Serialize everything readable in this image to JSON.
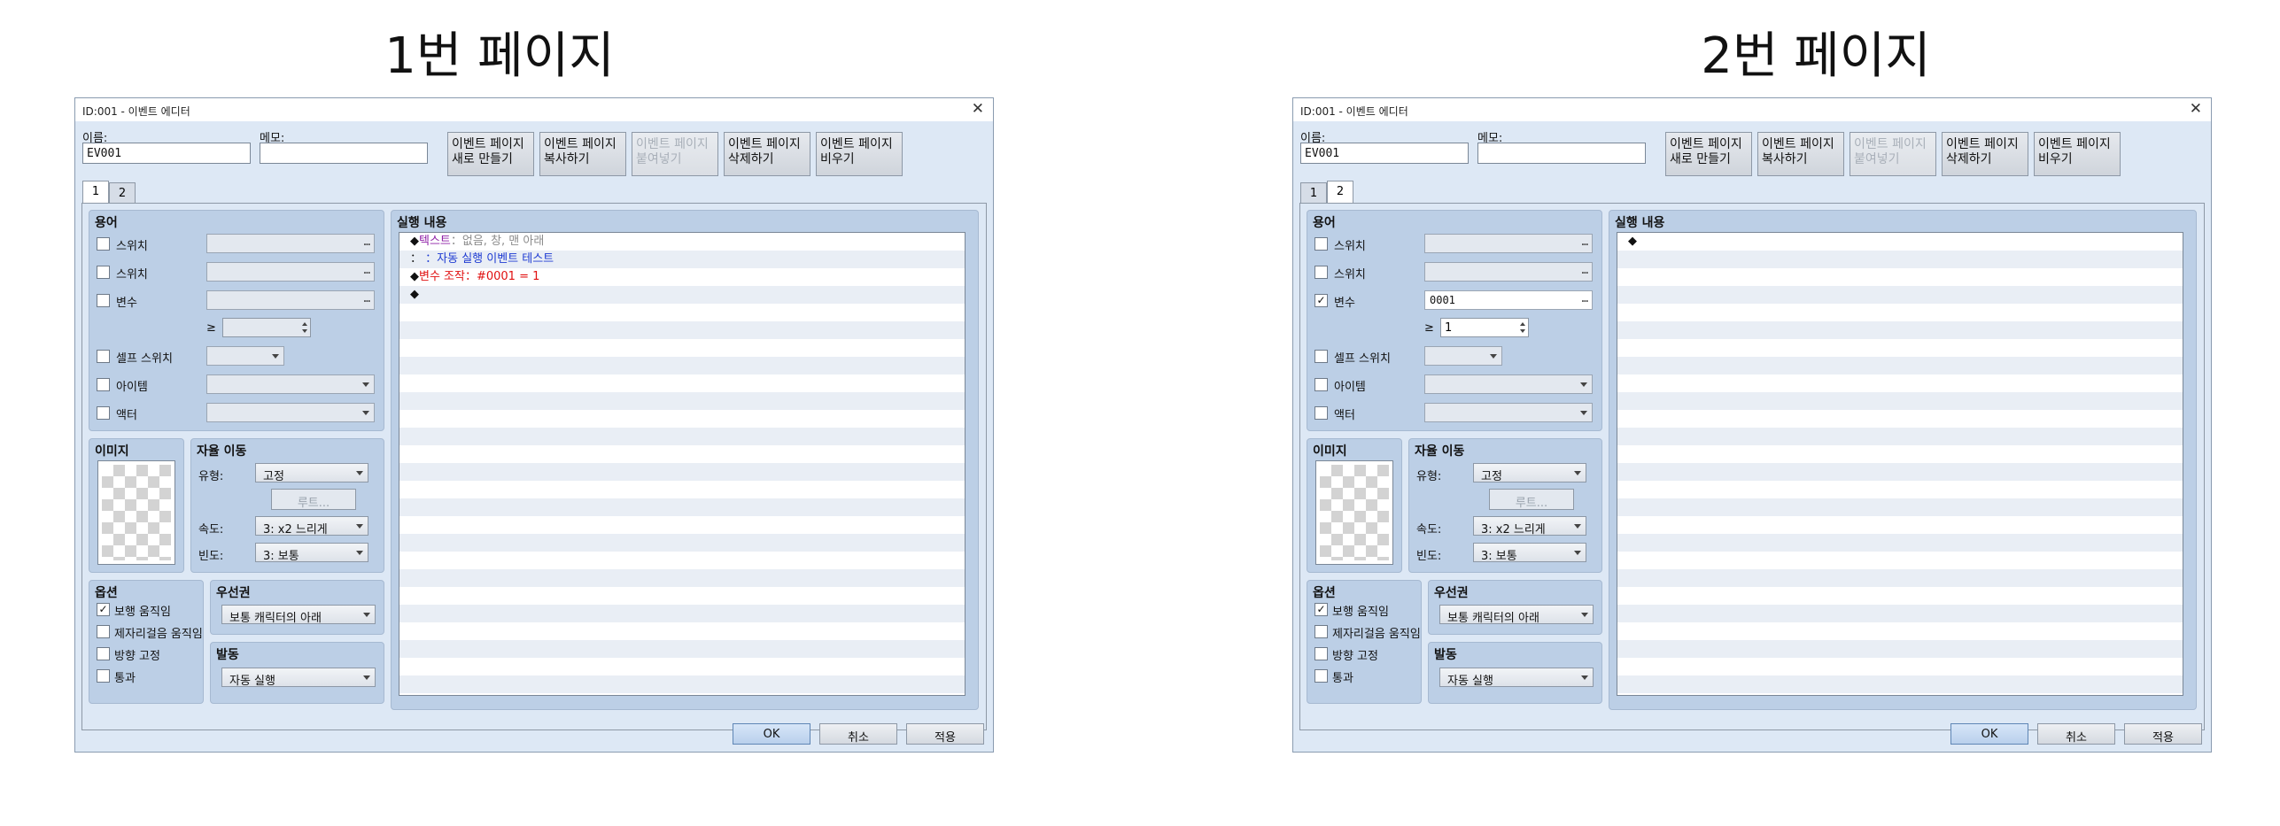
{
  "captions": [
    "1번 페이지",
    "2번 페이지"
  ],
  "dialogs": [
    {
      "title": "ID:001 - 이벤트 에디터",
      "close": "✕",
      "name_label": "이름:",
      "name_value": "EV001",
      "memo_label": "메모:",
      "memo_value": "",
      "page_buttons": [
        {
          "line1": "이벤트 페이지",
          "line2": "새로 만들기",
          "enabled": true
        },
        {
          "line1": "이벤트 페이지",
          "line2": "복사하기",
          "enabled": true
        },
        {
          "line1": "이벤트 페이지",
          "line2": "붙여넣기",
          "enabled": false
        },
        {
          "line1": "이벤트 페이지",
          "line2": "삭제하기",
          "enabled": true
        },
        {
          "line1": "이벤트 페이지",
          "line2": "비우기",
          "enabled": true
        }
      ],
      "tabs": [
        "1",
        "2"
      ],
      "active_tab": 0,
      "conditions": {
        "title": "용어",
        "switch1": "스위치",
        "switch2": "스위치",
        "variable": "변수",
        "variable_checked": false,
        "variable_value": "",
        "ge_symbol": "≥",
        "ge_value": "",
        "self_switch": "셀프 스위치",
        "item": "아이템",
        "actor": "액터",
        "dots": "…"
      },
      "image": {
        "title": "이미지"
      },
      "autonomous": {
        "title": "자율 이동",
        "type_label": "유형:",
        "type_value": "고정",
        "route_button": "루트...",
        "speed_label": "속도:",
        "speed_value": "3: x2 느리게",
        "freq_label": "빈도:",
        "freq_value": "3: 보통"
      },
      "options": {
        "title": "옵션",
        "walking": "보행 움직임",
        "walking_checked": true,
        "stepping": "제자리걸음 움직임",
        "dir_fix": "방향 고정",
        "through": "통과"
      },
      "priority": {
        "title": "우선권",
        "value": "보통 캐릭터의 아래"
      },
      "trigger": {
        "title": "발동",
        "value": "자동 실행"
      },
      "contents": {
        "title": "실행 내용",
        "rows": [
          [
            {
              "t": "◆",
              "c": "c-black"
            },
            {
              "t": "텍스트",
              "c": "c-purple"
            },
            {
              "t": "：없음, 창, 맨 아래",
              "c": "c-gray"
            }
          ],
          [
            {
              "t": "：",
              "c": "c-black"
            },
            {
              "t": "         ：자동 실행 이벤트 테스트",
              "c": "c-blue"
            }
          ],
          [
            {
              "t": "◆",
              "c": "c-black"
            },
            {
              "t": "변수 조작：#0001 = 1",
              "c": "c-red"
            }
          ],
          [
            {
              "t": "◆",
              "c": "c-black"
            }
          ]
        ]
      },
      "buttons": {
        "ok": "OK",
        "cancel": "취소",
        "apply": "적용"
      }
    },
    {
      "title": "ID:001 - 이벤트 에디터",
      "close": "✕",
      "name_label": "이름:",
      "name_value": "EV001",
      "memo_label": "메모:",
      "memo_value": "",
      "page_buttons": [
        {
          "line1": "이벤트 페이지",
          "line2": "새로 만들기",
          "enabled": true
        },
        {
          "line1": "이벤트 페이지",
          "line2": "복사하기",
          "enabled": true
        },
        {
          "line1": "이벤트 페이지",
          "line2": "붙여넣기",
          "enabled": false
        },
        {
          "line1": "이벤트 페이지",
          "line2": "삭제하기",
          "enabled": true
        },
        {
          "line1": "이벤트 페이지",
          "line2": "비우기",
          "enabled": true
        }
      ],
      "tabs": [
        "1",
        "2"
      ],
      "active_tab": 1,
      "conditions": {
        "title": "용어",
        "switch1": "스위치",
        "switch2": "스위치",
        "variable": "변수",
        "variable_checked": true,
        "variable_value": "0001",
        "ge_symbol": "≥",
        "ge_value": "1",
        "self_switch": "셀프 스위치",
        "item": "아이템",
        "actor": "액터",
        "dots": "…"
      },
      "image": {
        "title": "이미지"
      },
      "autonomous": {
        "title": "자율 이동",
        "type_label": "유형:",
        "type_value": "고정",
        "route_button": "루트...",
        "speed_label": "속도:",
        "speed_value": "3: x2 느리게",
        "freq_label": "빈도:",
        "freq_value": "3: 보통"
      },
      "options": {
        "title": "옵션",
        "walking": "보행 움직임",
        "walking_checked": true,
        "stepping": "제자리걸음 움직임",
        "dir_fix": "방향 고정",
        "through": "통과"
      },
      "priority": {
        "title": "우선권",
        "value": "보통 캐릭터의 아래"
      },
      "trigger": {
        "title": "발동",
        "value": "자동 실행"
      },
      "contents": {
        "title": "실행 내용",
        "rows": [
          [
            {
              "t": "◆",
              "c": "c-black"
            }
          ]
        ]
      },
      "buttons": {
        "ok": "OK",
        "cancel": "취소",
        "apply": "적용"
      }
    }
  ]
}
